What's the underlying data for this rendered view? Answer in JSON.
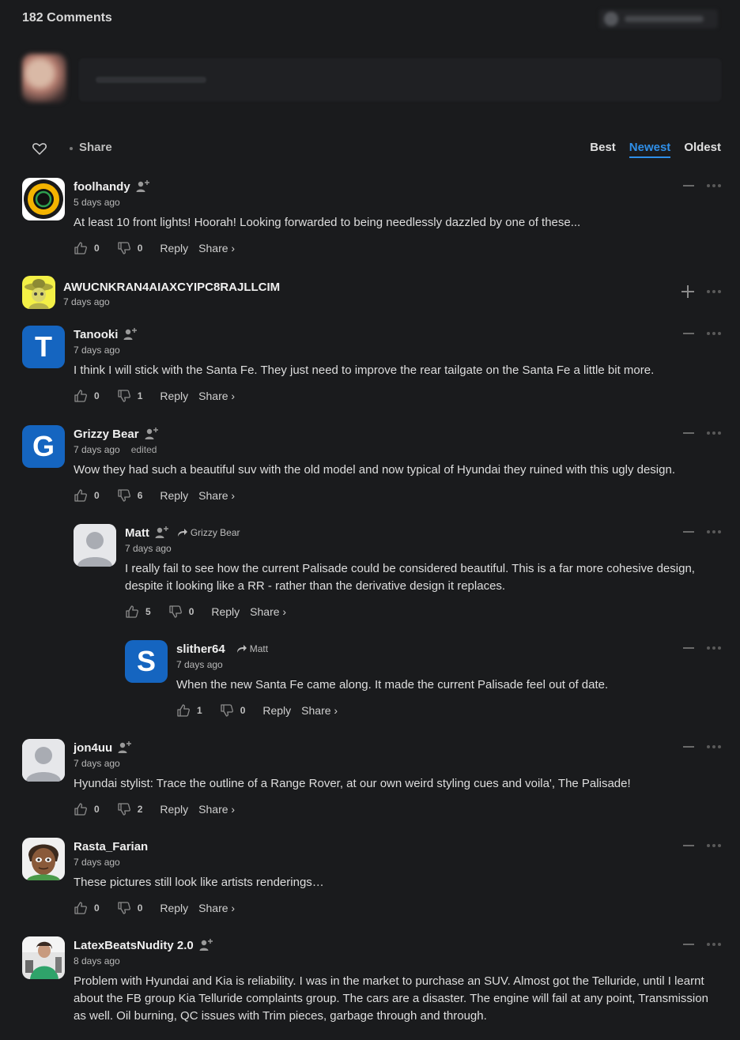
{
  "header": {
    "count_label": "182 Comments"
  },
  "toolbar": {
    "share_label": "Share",
    "sort_options": [
      "Best",
      "Newest",
      "Oldest"
    ],
    "active_sort": "Newest",
    "accent_color": "#2f8fe8"
  },
  "comments": [
    {
      "author": "foolhandy",
      "time": "5 days ago",
      "text": "At least 10 front lights! Hoorah! Looking forwarded to being needlessly dazzled by one of these...",
      "likes": "0",
      "dislikes": "0"
    },
    {
      "author": "AWUCNKRAN4AIAXCYIPC8RAJLLCIM",
      "time": "7 days ago"
    },
    {
      "author": "Tanooki",
      "avatar_letter": "T",
      "time": "7 days ago",
      "text": "I think I will stick with the Santa Fe. They just need to improve the rear tailgate on the Santa Fe a little bit more.",
      "likes": "0",
      "dislikes": "1"
    },
    {
      "author": "Grizzy Bear",
      "avatar_letter": "G",
      "time": "7 days ago",
      "edited": "edited",
      "text": "Wow they had such a beautiful suv with the old model and now typical of Hyundai they ruined with this ugly design.",
      "likes": "0",
      "dislikes": "6"
    },
    {
      "author": "Matt",
      "reply_to": "Grizzy Bear",
      "time": "7 days ago",
      "text": "I really fail to see how the current Palisade could be considered beautiful. This is a far more cohesive design, despite it looking like a RR - rather than the derivative design it replaces.",
      "likes": "5",
      "dislikes": "0"
    },
    {
      "author": "slither64",
      "avatar_letter": "S",
      "reply_to": "Matt",
      "time": "7 days ago",
      "text": "When the new Santa Fe came along. It made the current Palisade feel out of date.",
      "likes": "1",
      "dislikes": "0"
    },
    {
      "author": "jon4uu",
      "time": "7 days ago",
      "text": "Hyundai stylist: Trace the outline of a Range Rover, at our own weird styling cues and voila', The Palisade!",
      "likes": "0",
      "dislikes": "2"
    },
    {
      "author": "Rasta_Farian",
      "time": "7 days ago",
      "text": "These pictures still look like artists renderings…",
      "likes": "0",
      "dislikes": "0"
    },
    {
      "author": "LatexBeatsNudity 2.0",
      "time": "8 days ago",
      "text": "Problem with Hyundai and Kia is reliability. I was in the market to purchase an SUV. Almost got the Telluride, until I learnt about the FB group Kia Telluride complaints group. The cars are a disaster. The engine will fail at any point, Transmission as well. Oil burning, QC issues with Trim pieces, garbage through and through."
    }
  ],
  "actions": {
    "reply_label": "Reply",
    "share_label": "Share ›"
  },
  "icons": [
    "heart-icon",
    "follow-user-icon",
    "thumbs-up-icon",
    "thumbs-down-icon",
    "reply-arrow-icon",
    "collapse-icon",
    "expand-icon",
    "more-options-icon"
  ]
}
